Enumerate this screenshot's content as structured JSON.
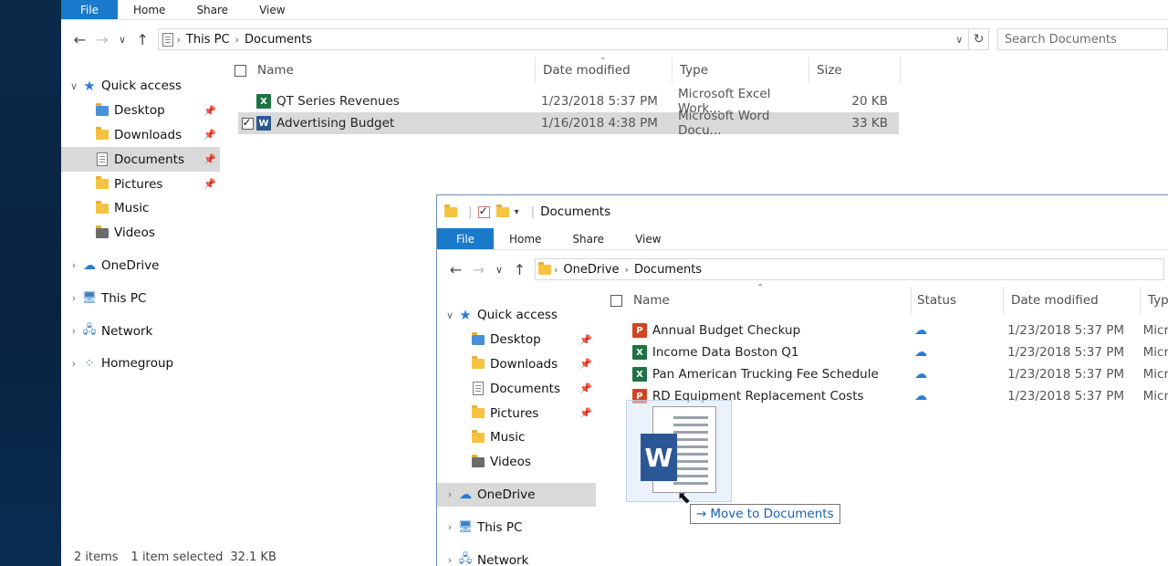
{
  "back_window": {
    "ribbon": {
      "file": "File",
      "home": "Home",
      "share": "Share",
      "view": "View"
    },
    "address": {
      "crumbs": [
        "This PC",
        "Documents"
      ]
    },
    "search_placeholder": "Search Documents",
    "nav": {
      "quick_access": "Quick access",
      "quick_items": [
        "Desktop",
        "Downloads",
        "Documents",
        "Pictures",
        "Music",
        "Videos"
      ],
      "onedrive": "OneDrive",
      "this_pc": "This PC",
      "network": "Network",
      "homegroup": "Homegroup"
    },
    "columns": {
      "name": "Name",
      "date": "Date modified",
      "type": "Type",
      "size": "Size"
    },
    "files": [
      {
        "name": "QT Series Revenues",
        "date": "1/23/2018 5:37 PM",
        "type": "Microsoft Excel Work...",
        "size": "20 KB"
      },
      {
        "name": "Advertising Budget",
        "date": "1/16/2018 4:38 PM",
        "type": "Microsoft Word Docu...",
        "size": "33 KB"
      }
    ],
    "status": {
      "items": "2 items",
      "selected": "1 item selected",
      "size": "32.1 KB"
    }
  },
  "front_window": {
    "title": "Documents",
    "ribbon": {
      "file": "File",
      "home": "Home",
      "share": "Share",
      "view": "View"
    },
    "address": {
      "crumbs": [
        "OneDrive",
        "Documents"
      ]
    },
    "nav": {
      "quick_access": "Quick access",
      "quick_items": [
        "Desktop",
        "Downloads",
        "Documents",
        "Pictures",
        "Music",
        "Videos"
      ],
      "onedrive": "OneDrive",
      "this_pc": "This PC",
      "network": "Network"
    },
    "columns": {
      "name": "Name",
      "status": "Status",
      "date": "Date modified",
      "type": "Type"
    },
    "files": [
      {
        "name": "Annual Budget Checkup",
        "kind": "powerpoint",
        "date": "1/23/2018 5:37 PM",
        "type": "Micr"
      },
      {
        "name": "Income Data Boston Q1",
        "kind": "excel",
        "date": "1/23/2018 5:37 PM",
        "type": "Micr"
      },
      {
        "name": "Pan American Trucking Fee Schedule",
        "kind": "excel",
        "date": "1/23/2018 5:37 PM",
        "type": "Micr"
      },
      {
        "name": "RD Equipment Replacement Costs",
        "kind": "powerpoint",
        "date": "1/23/2018 5:37 PM",
        "type": "Micr"
      }
    ]
  },
  "drag_tooltip": "Move to Documents",
  "colors": {
    "accent": "#1979ca",
    "selection": "#d9d9d9",
    "excel": "#1f7244",
    "word": "#2b5797",
    "powerpoint": "#d04423",
    "cloud": "#2b7cd3"
  }
}
